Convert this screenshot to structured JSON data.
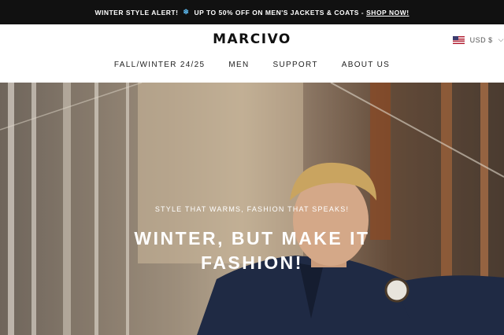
{
  "announcement": {
    "prefix": "WINTER STYLE ALERT!",
    "icon": "snowflake-icon",
    "message": "UP TO 50% OFF ON MEN'S JACKETS & COATS -",
    "link_label": "SHOP NOW!"
  },
  "header": {
    "logo": "MARCIVO",
    "currency": {
      "label": "USD $",
      "flag_icon": "us-flag-icon",
      "chevron_icon": "chevron-down-icon"
    }
  },
  "nav": {
    "items": [
      {
        "label": "FALL/WINTER 24/25"
      },
      {
        "label": "MEN"
      },
      {
        "label": "SUPPORT"
      },
      {
        "label": "ABOUT US"
      }
    ]
  },
  "hero": {
    "kicker": "STYLE THAT WARMS, FASHION THAT SPEAKS!",
    "headline_line1": "WINTER, BUT MAKE IT",
    "headline_line2": "FASHION!"
  },
  "colors": {
    "announcement_bg": "#111111",
    "snowflake": "#5ab4e8",
    "text_dark": "#111111"
  }
}
